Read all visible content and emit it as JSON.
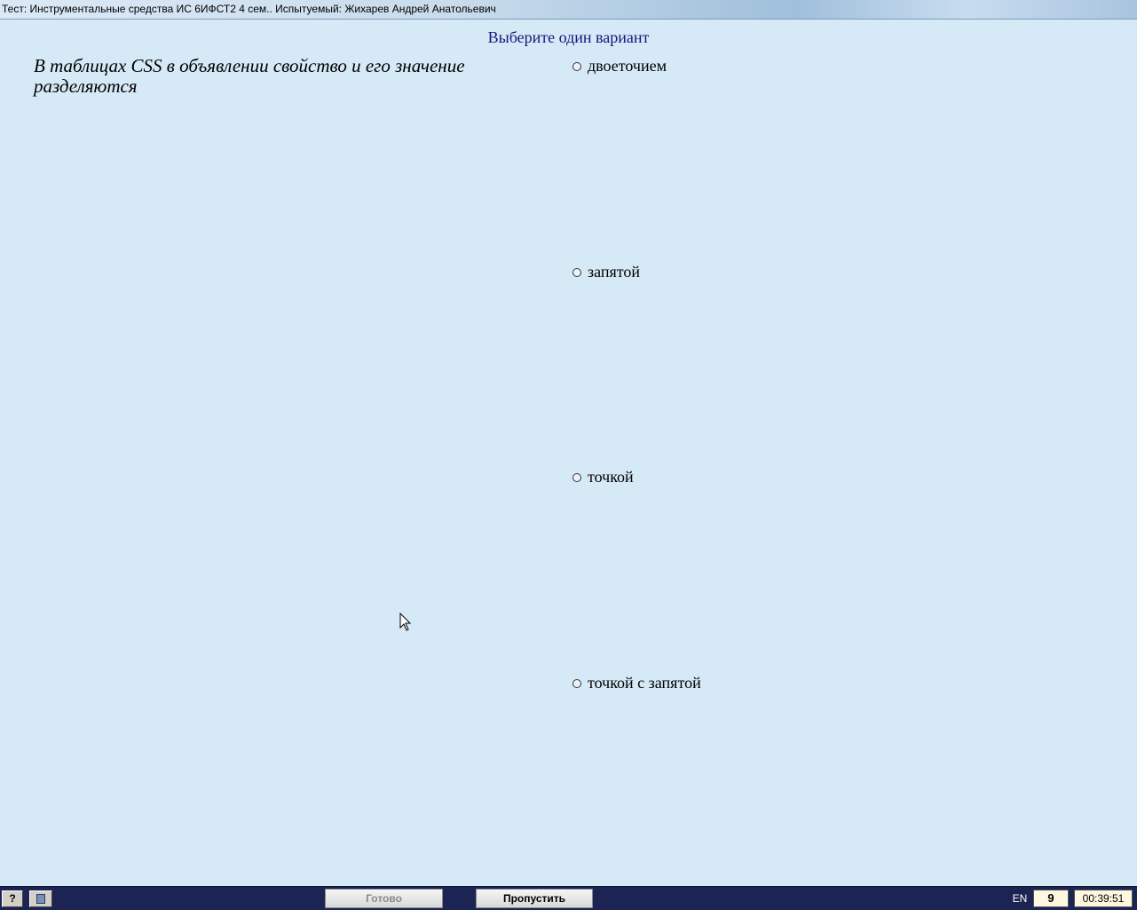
{
  "window": {
    "title": "Тест: Инструментальные средства ИС 6ИФСТ2 4 сем.. Испытуемый: Жихарев Андрей Анатольевич"
  },
  "instruction": "Выберите один вариант",
  "question": {
    "text": "В таблицах CSS в объявлении свойство и его значение разделяются"
  },
  "options": [
    {
      "label": "двоеточием",
      "selected": false
    },
    {
      "label": "запятой",
      "selected": false
    },
    {
      "label": "точкой",
      "selected": false
    },
    {
      "label": "точкой с запятой",
      "selected": false
    }
  ],
  "bottombar": {
    "help_label": "?",
    "done_label": "Готово",
    "skip_label": "Пропустить",
    "language": "EN",
    "question_number": "9",
    "timer": "00:39:51"
  },
  "icons": {
    "help": "help-icon",
    "list": "document-list-icon",
    "radio": "radio-circle-icon",
    "cursor": "mouse-pointer-icon"
  }
}
